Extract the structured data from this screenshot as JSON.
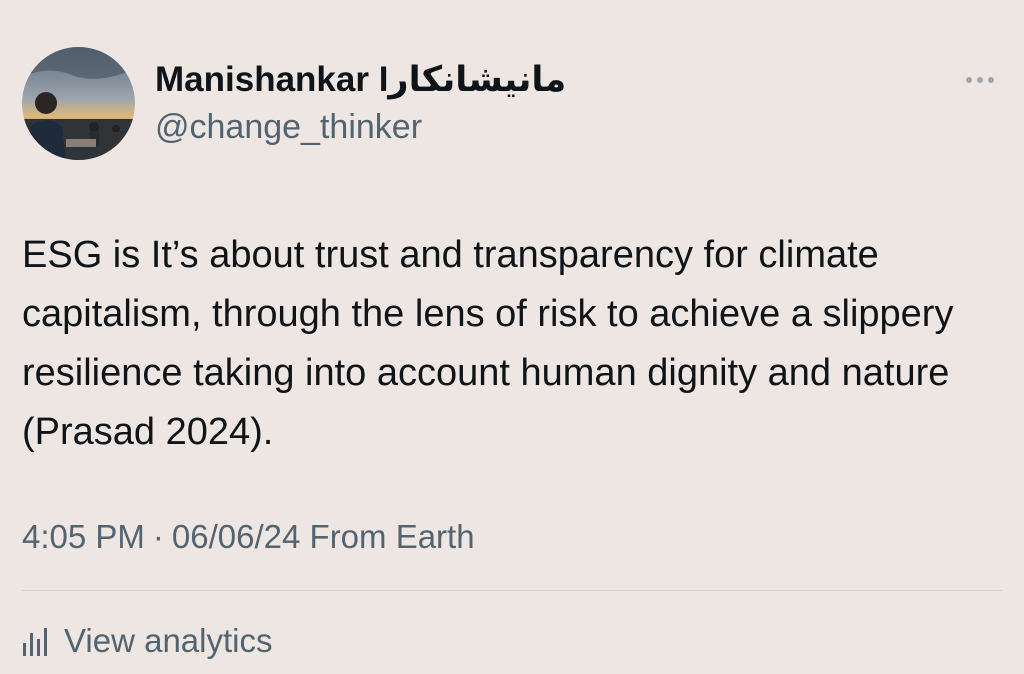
{
  "author": {
    "display_name": "Manishankar Iمانیشانکار",
    "handle": "@change_thinker",
    "avatar_icon": "profile-photo"
  },
  "more_icon": "more-horizontal-icon",
  "tweet": {
    "text": "ESG is It’s about trust and transparency for climate capitalism, through the lens of risk to achieve a slippery resilience taking into account human dignity and nature (Prasad 2024)."
  },
  "meta": {
    "time": "4:05 PM",
    "separator": "·",
    "date_source": "06/06/24 From Earth"
  },
  "analytics": {
    "icon": "bar-chart-icon",
    "label": "View analytics"
  },
  "colors": {
    "background": "#ede6e2",
    "text_primary": "#0f1419",
    "text_secondary": "#536471"
  }
}
